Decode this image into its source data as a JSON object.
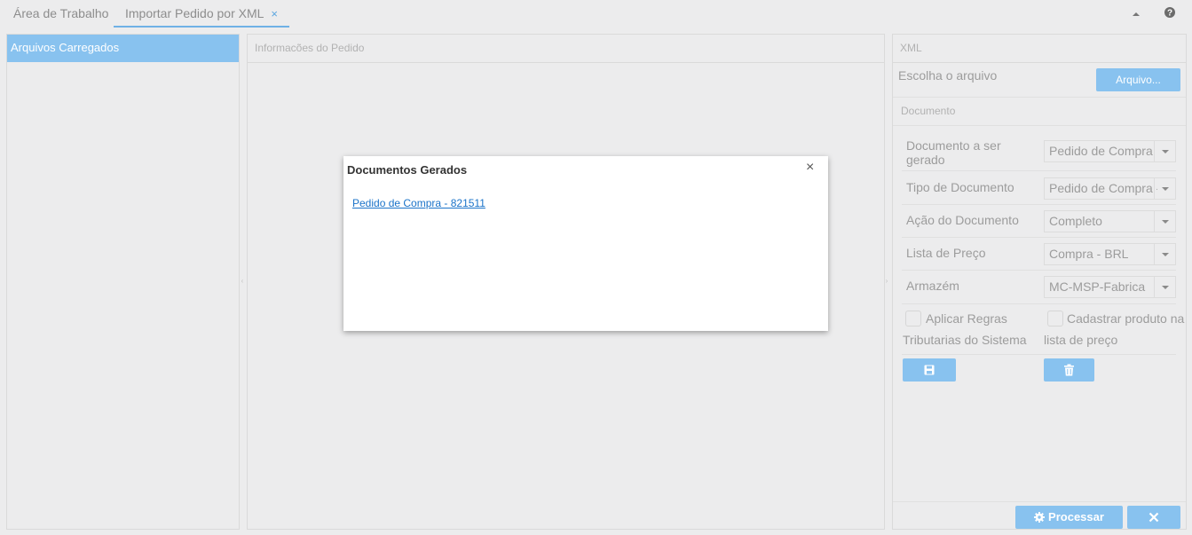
{
  "tabs": [
    {
      "label": "Área de Trabalho"
    },
    {
      "label": "Importar Pedido por XML",
      "close": "×"
    }
  ],
  "toolbar": {
    "collapse_icon": "caret-up-icon",
    "help_icon": "help-icon"
  },
  "left_panel": {
    "title": "Arquivos Carregados"
  },
  "center_panel": {
    "title": "Informacões do Pedido"
  },
  "xml_section": {
    "title": "XML",
    "choose_label": "Escolha o arquivo",
    "file_button": "Arquivo..."
  },
  "document_section": {
    "title": "Documento",
    "fields": [
      {
        "label": "Documento a ser gerado",
        "value": "Pedido de Compra"
      },
      {
        "label": "Tipo de Documento",
        "value": "Pedido de Compra - Comum"
      },
      {
        "label": "Ação do Documento",
        "value": "Completo"
      },
      {
        "label": "Lista de Preço",
        "value": "Compra - BRL"
      },
      {
        "label": "Armazém",
        "value": "MC-MSP-Fabrica"
      }
    ],
    "checkboxes": [
      {
        "label_line1": "Aplicar Regras",
        "label_line2": "Tributarias do Sistema"
      },
      {
        "label_line1": "Cadastrar produto na",
        "label_line2": "lista de preço"
      }
    ],
    "save_icon": "save-icon",
    "delete_icon": "trash-icon"
  },
  "footer": {
    "process_label": "Processar",
    "process_icon": "gear-icon",
    "cancel_icon": "close-icon"
  },
  "modal": {
    "title": "Documentos Gerados",
    "close": "×",
    "link_text": "Pedido de Compra - 821511"
  },
  "colors": {
    "accent": "#88c2ef",
    "link": "#1a73c9",
    "background": "#ececed"
  }
}
